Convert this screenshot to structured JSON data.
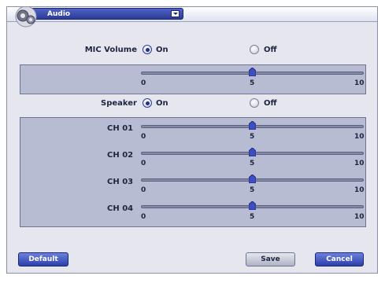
{
  "window": {
    "title": "Audio",
    "icon": "gear-icon"
  },
  "mic": {
    "label": "MIC Volume",
    "on_label": "On",
    "off_label": "Off",
    "selected": "On",
    "slider": {
      "min_label": "0",
      "mid_label": "5",
      "max_label": "10",
      "value": 5
    }
  },
  "speaker": {
    "label": "Speaker",
    "on_label": "On",
    "off_label": "Off",
    "selected": "On",
    "channels": [
      {
        "label": "CH 01",
        "min_label": "0",
        "mid_label": "5",
        "max_label": "10",
        "value": 5
      },
      {
        "label": "CH 02",
        "min_label": "0",
        "mid_label": "5",
        "max_label": "10",
        "value": 5
      },
      {
        "label": "CH 03",
        "min_label": "0",
        "mid_label": "5",
        "max_label": "10",
        "value": 5
      },
      {
        "label": "CH 04",
        "min_label": "0",
        "mid_label": "5",
        "max_label": "10",
        "value": 5
      }
    ]
  },
  "buttons": {
    "default_label": "Default",
    "save_label": "Save",
    "cancel_label": "Cancel"
  },
  "colors": {
    "accent": "#2a3a96",
    "panel": "#b7bcd3",
    "window": "#e6e7ee"
  }
}
